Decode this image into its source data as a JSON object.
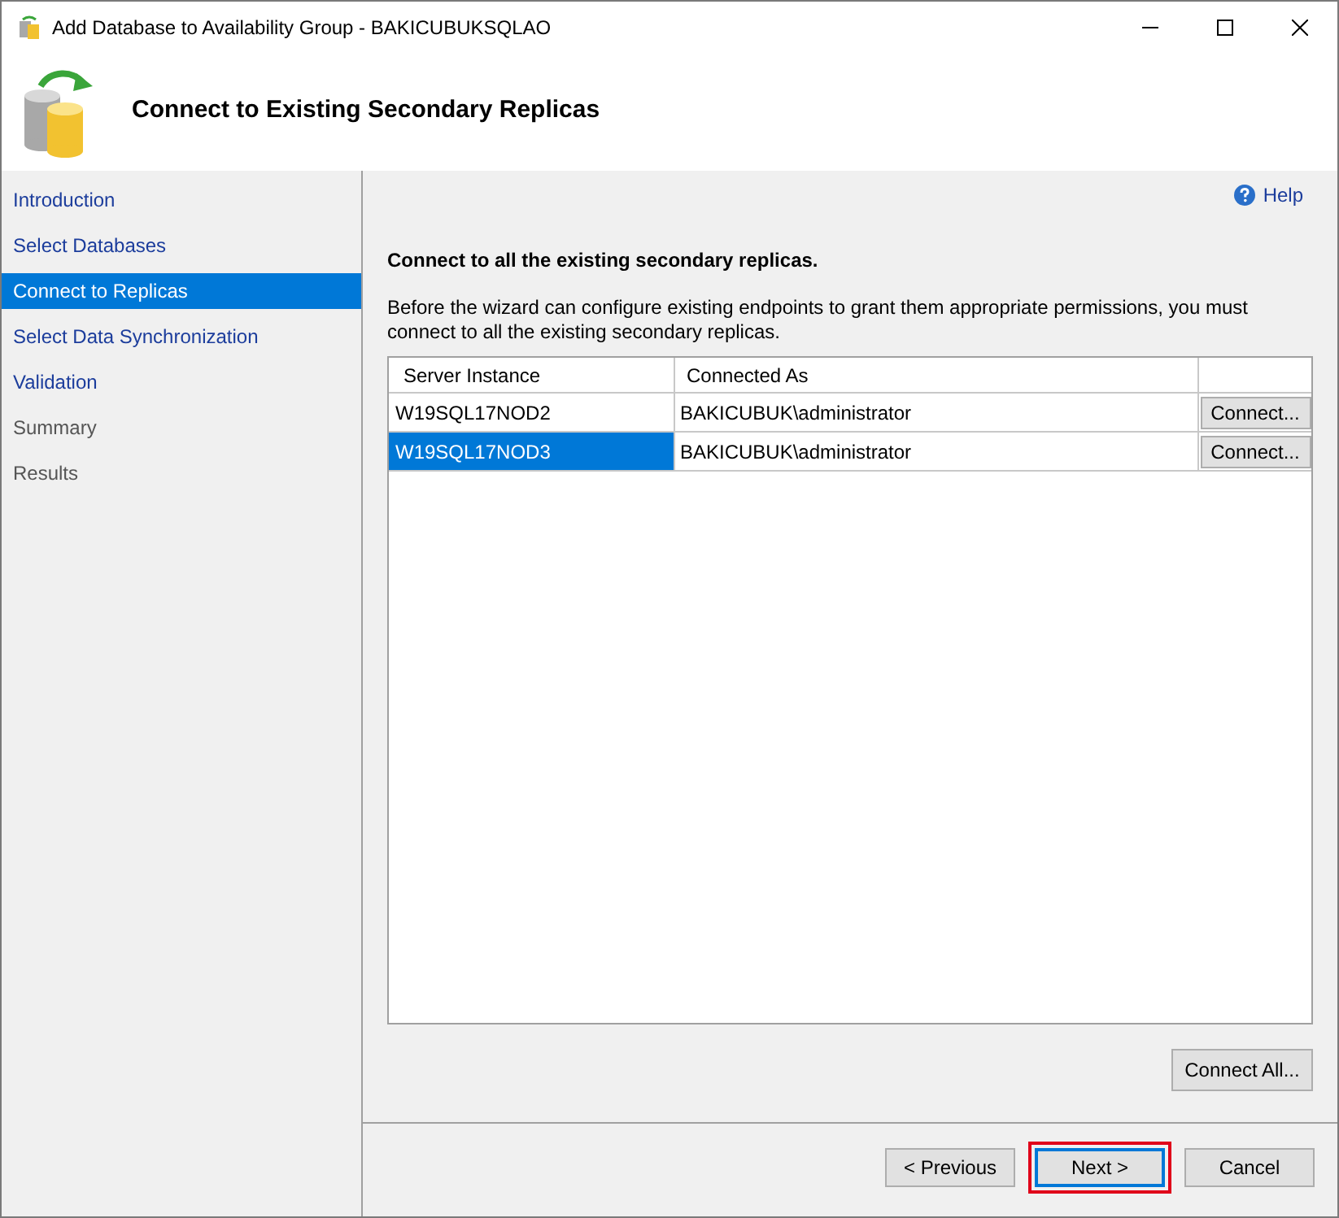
{
  "window": {
    "title": "Add Database to Availability Group - BAKICUBUKSQLAO"
  },
  "header": {
    "title": "Connect to Existing Secondary Replicas"
  },
  "sidebar": {
    "items": [
      {
        "label": "Introduction",
        "selected": false,
        "disabled": false
      },
      {
        "label": "Select Databases",
        "selected": false,
        "disabled": false
      },
      {
        "label": "Connect to Replicas",
        "selected": true,
        "disabled": false
      },
      {
        "label": "Select Data Synchronization",
        "selected": false,
        "disabled": false
      },
      {
        "label": "Validation",
        "selected": false,
        "disabled": false
      },
      {
        "label": "Summary",
        "selected": false,
        "disabled": true
      },
      {
        "label": "Results",
        "selected": false,
        "disabled": true
      }
    ]
  },
  "help": {
    "label": "Help"
  },
  "instruction": "Connect to all the existing secondary replicas.",
  "description": "Before the wizard can configure existing endpoints to grant them appropriate permissions, you must connect to all the existing secondary replicas.",
  "table": {
    "columns": [
      "Server Instance",
      "Connected As"
    ],
    "rows": [
      {
        "server_instance": "W19SQL17NOD2",
        "connected_as": "BAKICUBUK\\administrator",
        "button": "Connect...",
        "selected": false
      },
      {
        "server_instance": "W19SQL17NOD3",
        "connected_as": "BAKICUBUK\\administrator",
        "button": "Connect...",
        "selected": true
      }
    ]
  },
  "connect_all_button": "Connect All...",
  "footer_buttons": [
    {
      "label": "< Previous",
      "highlighted": false
    },
    {
      "label": "Next >",
      "highlighted": true
    },
    {
      "label": "Cancel",
      "highlighted": false
    }
  ]
}
